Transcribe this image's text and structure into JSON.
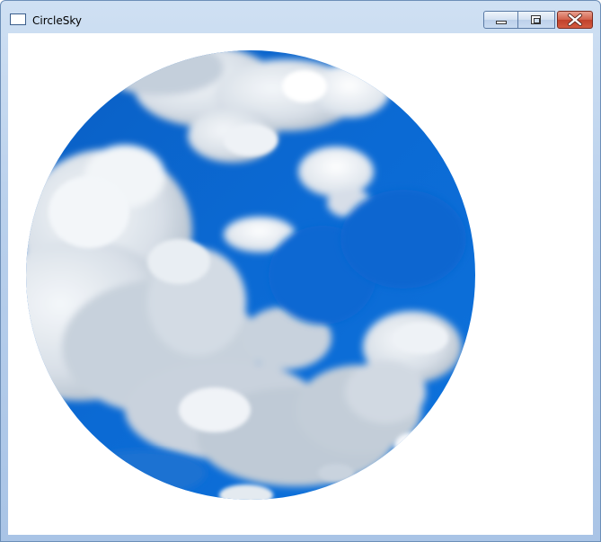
{
  "window": {
    "title": "CircleSky",
    "icon": "window-icon"
  },
  "controls": {
    "minimize": "minimize-icon",
    "maximize": "maximize-icon",
    "close": "close-icon"
  },
  "content": {
    "image": "sky-clouds-circle",
    "sky_color": "#0b6ad4",
    "cloud_color": "#dfe6ee"
  }
}
